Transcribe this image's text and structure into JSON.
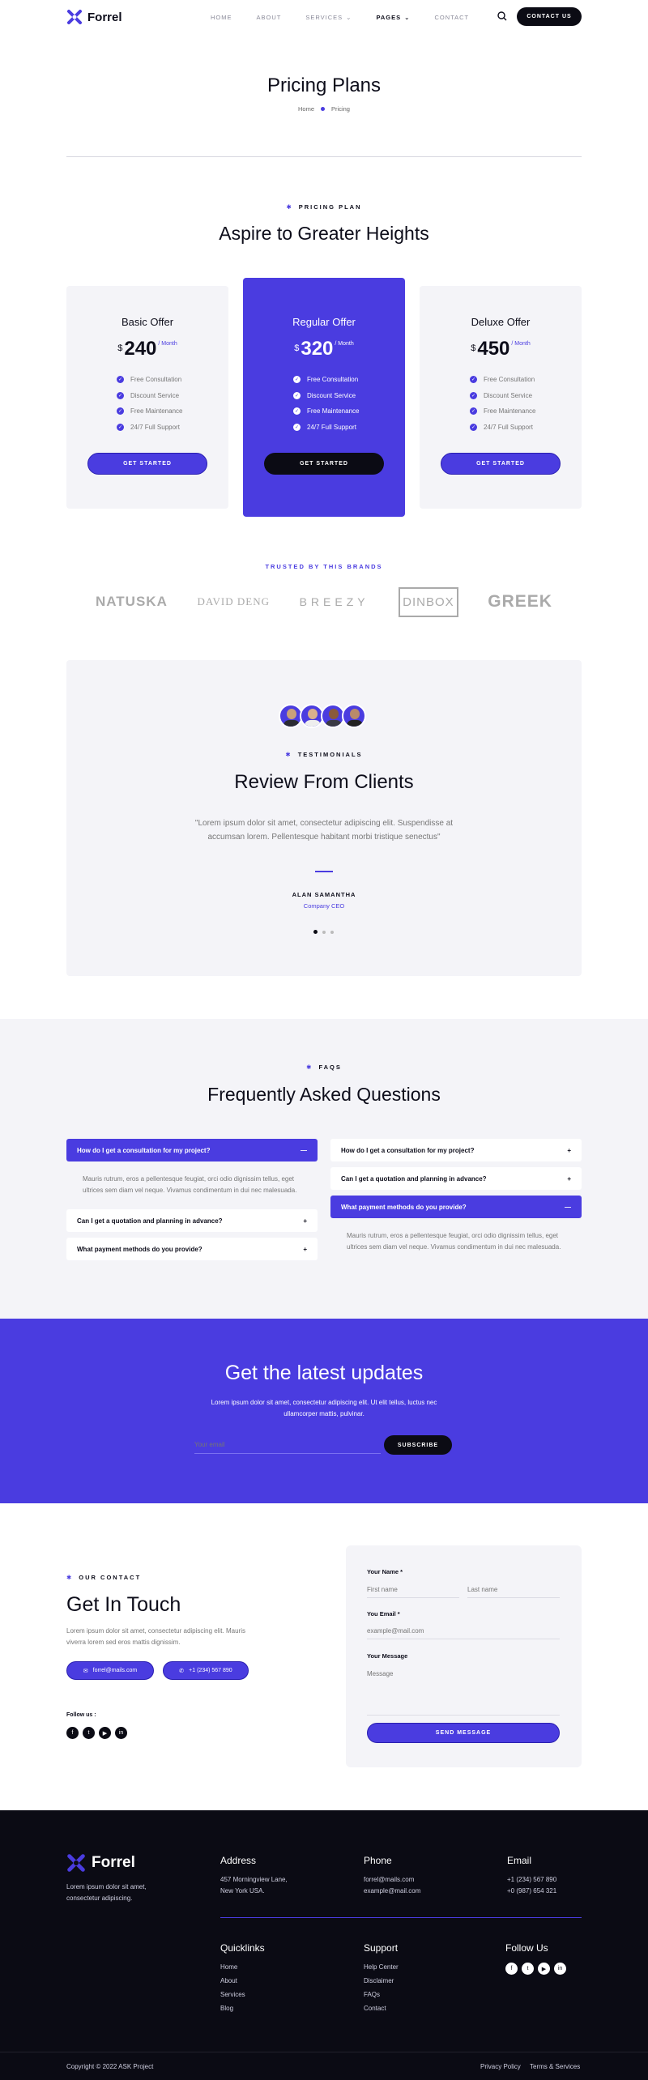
{
  "header": {
    "brand": "Forrel",
    "nav": [
      {
        "label": "HOME"
      },
      {
        "label": "ABOUT"
      },
      {
        "label": "SERVICES",
        "caret": true
      },
      {
        "label": "PAGES",
        "caret": true,
        "active": true
      },
      {
        "label": "CONTACT"
      }
    ],
    "cta": "CONTACT US"
  },
  "hero": {
    "title": "Pricing Plans",
    "crumb_home": "Home",
    "crumb_current": "Pricing"
  },
  "pricing": {
    "eyebrow": "PRICING PLAN",
    "title": "Aspire to Greater Heights",
    "plans": [
      {
        "name": "Basic Offer",
        "currency": "$",
        "price": "240",
        "period": "/ Month",
        "features": [
          "Free Consultation",
          "Discount Service",
          "Free Maintenance",
          "24/7 Full Support"
        ],
        "button": "GET STARTED"
      },
      {
        "name": "Regular Offer",
        "currency": "$",
        "price": "320",
        "period": "/ Month",
        "features": [
          "Free Consultation",
          "Discount Service",
          "Free Maintenance",
          "24/7 Full Support"
        ],
        "button": "GET STARTED"
      },
      {
        "name": "Deluxe Offer",
        "currency": "$",
        "price": "450",
        "period": "/ Month",
        "features": [
          "Free Consultation",
          "Discount Service",
          "Free Maintenance",
          "24/7 Full Support"
        ],
        "button": "GET STARTED"
      }
    ]
  },
  "brands": {
    "eyebrow": "TRUSTED BY THIS BRANDS",
    "items": [
      "NATUSKA",
      "DAVID DENG",
      "BREEZY",
      "DINBOX",
      "GREEK"
    ]
  },
  "testimonials": {
    "eyebrow": "TESTIMONIALS",
    "title": "Review From Clients",
    "quote": "\"Lorem ipsum dolor sit amet, consectetur adipiscing elit. Suspendisse at accumsan lorem. Pellentesque habitant morbi tristique senectus\"",
    "author": "ALAN SAMANTHA",
    "role": "Company CEO"
  },
  "faq": {
    "eyebrow": "FAQS",
    "title": "Frequently Asked Questions",
    "left": [
      {
        "q": "How do I get a consultation for my project?",
        "open": true,
        "a": "Mauris rutrum, eros a pellentesque feugiat, orci odio dignissim tellus, eget ultrices sem diam vel neque. Vivamus condimentum in dui nec malesuada."
      },
      {
        "q": "Can I get a quotation and planning in advance?"
      },
      {
        "q": "What payment methods do you provide?"
      }
    ],
    "right": [
      {
        "q": "How do I get a consultation for my project?"
      },
      {
        "q": "Can I get a quotation and planning in advance?"
      },
      {
        "q": "What payment methods do you provide?",
        "open": true,
        "a": "Mauris rutrum, eros a pellentesque feugiat, orci odio dignissim tellus, eget ultrices sem diam vel neque. Vivamus condimentum in dui nec malesuada."
      }
    ]
  },
  "newsletter": {
    "title": "Get the latest updates",
    "text": "Lorem ipsum dolor sit amet, consectetur adipiscing elit. Ut elit tellus, luctus nec ullamcorper mattis, pulvinar.",
    "placeholder": "Your email",
    "button": "SUBSCRIBE"
  },
  "contact": {
    "eyebrow": "OUR CONTACT",
    "title": "Get In Touch",
    "text": "Lorem ipsum dolor sit amet, consectetur adipiscing elit. Mauris viverra lorem sed eros mattis dignissim.",
    "email": "forrel@mails.com",
    "phone": "+1 (234) 567 890",
    "follow": "Follow us :",
    "form": {
      "name_label": "Your Name *",
      "first": "First name",
      "last": "Last name",
      "email_label": "You Email *",
      "email_ph": "example@mail.com",
      "msg_label": "Your Message",
      "msg_ph": "Message",
      "button": "SEND MESSAGE"
    }
  },
  "footer": {
    "brand": "Forrel",
    "tagline": "Lorem ipsum dolor sit amet, consectetur adipiscing.",
    "address_h": "Address",
    "address": [
      "457 Morningview Lane,",
      "New York USA."
    ],
    "phone_h": "Phone",
    "phones": [
      "forrel@mails.com",
      "example@mail.com"
    ],
    "email_h": "Email",
    "emails": [
      "+1 (234) 567 890",
      "+0 (987) 654 321"
    ],
    "quick_h": "Quicklinks",
    "quick": [
      "Home",
      "About",
      "Services",
      "Blog"
    ],
    "support_h": "Support",
    "support": [
      "Help Center",
      "Disclaimer",
      "FAQs",
      "Contact"
    ],
    "follow_h": "Follow Us",
    "copyright": "Copyright © 2022 ASK Project",
    "privacy": "Privacy Policy",
    "terms": "Terms & Services"
  },
  "colors": {
    "accent": "#4a3ce0",
    "dark": "#0b0b14",
    "light": "#f4f4f8"
  }
}
